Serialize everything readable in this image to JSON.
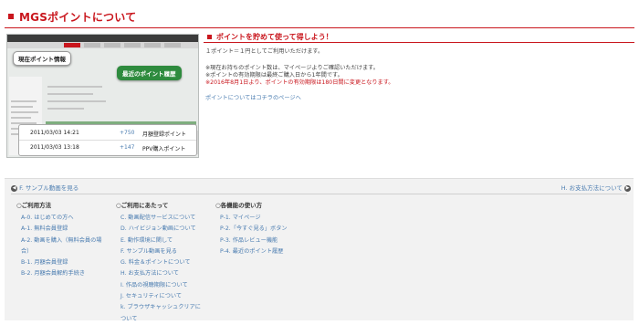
{
  "header": {
    "title": "MGSポイントについて"
  },
  "thumbnail": {
    "callout_current": "現在ポイント情報",
    "callout_history": "最近のポイント履歴",
    "rows": [
      {
        "date": "2011/03/03 14:21",
        "points": "+750",
        "desc": "月額登録ポイント"
      },
      {
        "date": "2011/03/03 13:18",
        "points": "+147",
        "desc": "PPV購入ポイント"
      }
    ]
  },
  "right": {
    "heading": "ポイントを貯めて使って得しよう！",
    "rate": "１ポイント＝１円としてご利用いただけます。",
    "note1": "※現在お持ちのポイント数は、マイページよりご確認いただけます。",
    "note2": "※ポイントの有効期限は最終ご購入日から1年間です。",
    "note3": "※2016年8月1日より、ポイントの有効期限は180日間に変更となります。",
    "link": "ポイントについてはコチラのページへ"
  },
  "bottom": {
    "prev_label": "F. サンプル動画を見る",
    "next_label": "H. お支払方法について",
    "columns": [
      {
        "heading": "○ご利用方法",
        "items": [
          "A-0. はじめての方へ",
          "A-1. 無料会員登録",
          "A-2. 動画を購入（無料会員の場",
          "合）",
          "B-1. 月額会員登録",
          "B-2. 月額会員解約手続き"
        ]
      },
      {
        "heading": "○ご利用にあたって",
        "items": [
          "C. 動画配信サービスについて",
          "D. ハイビジョン動画について",
          "E. 動作環境に関して",
          "F. サンプル動画を見る",
          "G. 料金＆ポイントについて",
          "H. お支払方法について",
          "I. 作品の視聴期限について",
          "J. セキュリティについて",
          "k. ブラウザキャッシュクリアに",
          "ついて"
        ]
      },
      {
        "heading": "○各機能の使い方",
        "items": [
          "P-1. マイページ",
          "P-2.「今すぐ見る」ボタン",
          "P-3. 作品レビュー機能",
          "P-4. 最近のポイント履歴"
        ]
      }
    ]
  }
}
